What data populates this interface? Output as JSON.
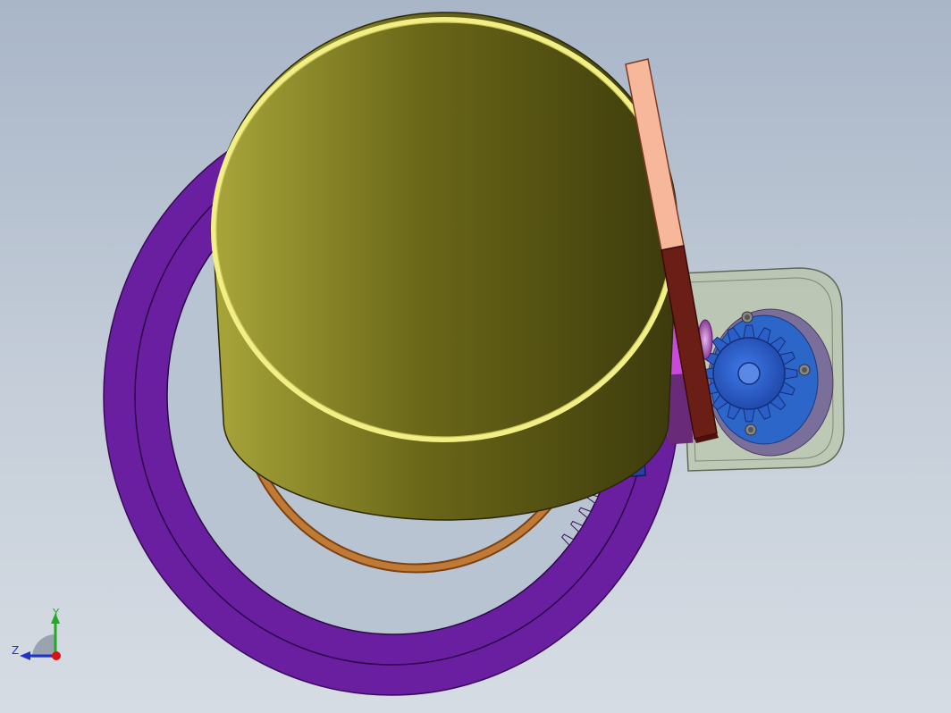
{
  "triad": {
    "y_label": "Y",
    "z_label": "Z"
  },
  "colors": {
    "background_top": "#a9b6c8",
    "background_bottom": "#d6dce3",
    "ring_gear": "#6a1fa0",
    "cylinder_shell": "#6e6a14",
    "cylinder_rim": "#f2ef86",
    "inner_ring": "#b06a2a",
    "blue_block": "#2f8fd8",
    "rack": "#f7b79a",
    "rack_dark": "#6b1e16",
    "pinion": "#2c5ec8",
    "motor_plate": "#b6c4a8",
    "bracket": "#2a3ea8",
    "magenta_plate": "#d24ce8",
    "axis_y": "#22aa22",
    "axis_z": "#2233cc",
    "axis_x": "#dd1111"
  }
}
